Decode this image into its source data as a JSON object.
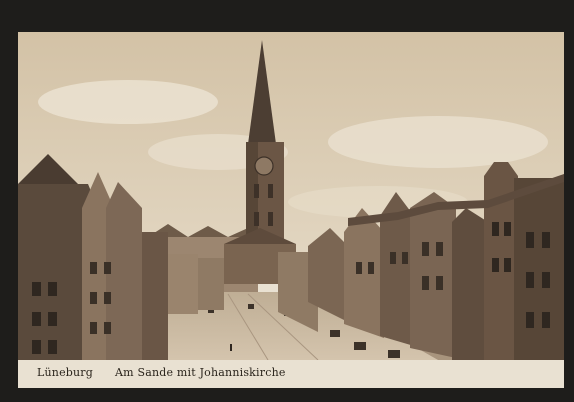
{
  "card": {
    "caption_city": "Lüneburg",
    "caption_place": "Am Sande mit Johanniskirche"
  },
  "colors": {
    "frame": "#1e1d1b",
    "paper": "#e9e1d2",
    "sky": "#d9cab1",
    "building_dark": "#5a4a3c",
    "building_mid": "#8a745f",
    "street": "#c9b8a0"
  }
}
